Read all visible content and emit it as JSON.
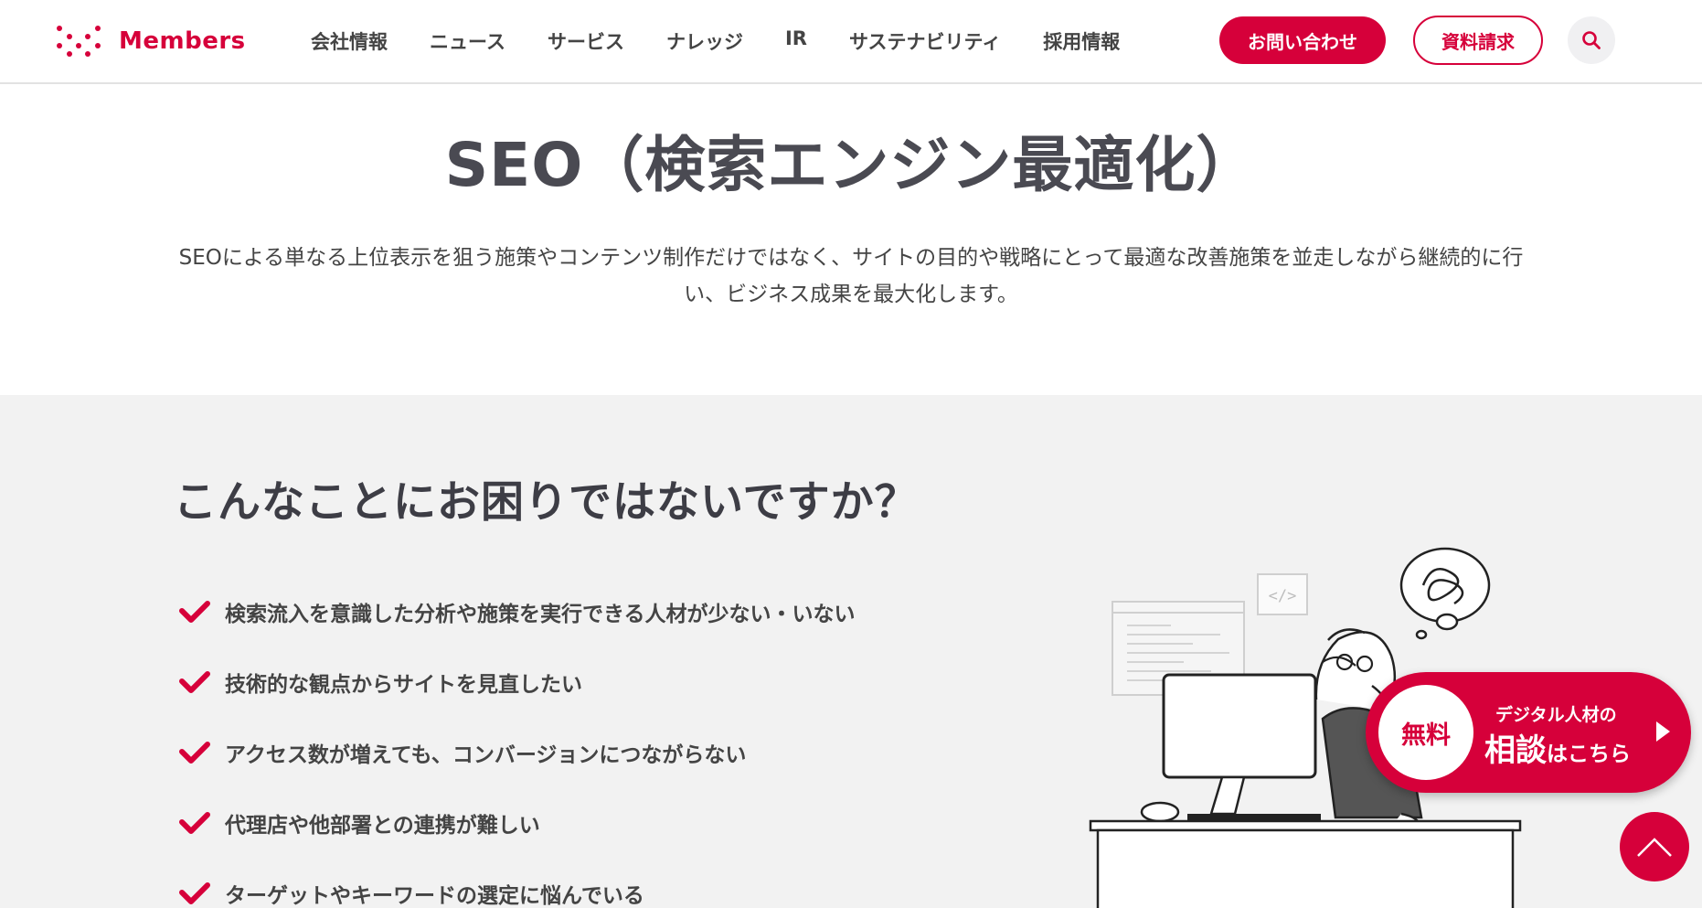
{
  "brand": {
    "name": "Members",
    "color": "#d6003a",
    "logo_icon": "members-dot-logo-icon"
  },
  "nav": {
    "items": [
      "会社情報",
      "ニュース",
      "サービス",
      "ナレッジ",
      "IR",
      "サステナビリティ",
      "採用情報"
    ],
    "contact_label": "お問い合わせ",
    "docs_label": "資料請求",
    "search_icon": "search-icon"
  },
  "hero": {
    "title": "SEO（検索エンジン最適化）",
    "description": "SEOによる単なる上位表示を狙う施策やコンテンツ制作だけではなく、サイトの目的や戦略にとって最適な改善施策を並走しながら継続的に行い、ビジネス成果を最大化します。"
  },
  "problems": {
    "title": "こんなことにお困りではないですか？",
    "items": [
      "検索流入を意識した分析や施策を実行できる人材が少ない・いない",
      "技術的な観点からサイトを見直したい",
      "アクセス数が増えても、コンバージョンにつながらない",
      "代理店や他部署との連携が難しい",
      "ターゲットやキーワードの選定に悩んでいる"
    ],
    "check_icon": "check-icon",
    "illustration": "worried-person-at-computer-illustration"
  },
  "cta": {
    "badge": "無料",
    "line1": "デジタル人材の",
    "main": "相談",
    "sub": "はこちら",
    "arrow_icon": "play-arrow-icon"
  },
  "to_top_icon": "chevron-up-icon"
}
